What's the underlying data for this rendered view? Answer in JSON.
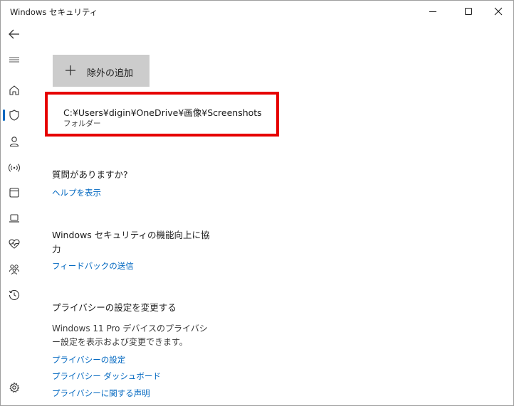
{
  "window": {
    "title": "Windows セキュリティ"
  },
  "sidebar": {
    "items": [
      {
        "icon": "back-arrow-icon"
      },
      {
        "icon": "hamburger-menu-icon"
      },
      {
        "icon": "home-icon"
      },
      {
        "icon": "shield-icon",
        "selected": true
      },
      {
        "icon": "person-icon"
      },
      {
        "icon": "wifi-antenna-icon"
      },
      {
        "icon": "app-browser-icon"
      },
      {
        "icon": "laptop-icon"
      },
      {
        "icon": "heart-pulse-icon"
      },
      {
        "icon": "family-icon"
      },
      {
        "icon": "history-icon"
      },
      {
        "icon": "gear-icon"
      }
    ]
  },
  "main": {
    "add_button_label": "除外の追加",
    "exclusion": {
      "path": "C:¥Users¥digin¥OneDrive¥画像¥Screenshots",
      "type": "フォルダー"
    },
    "help": {
      "heading": "質問がありますか?",
      "link": "ヘルプを表示"
    },
    "feedback": {
      "heading": "Windows セキュリティの機能向上に協力",
      "link": "フィードバックの送信"
    },
    "privacy": {
      "heading": "プライバシーの設定を変更する",
      "description": "Windows 11 Pro デバイスのプライバシー設定を表示および変更できます。",
      "links": [
        "プライバシーの設定",
        "プライバシー ダッシュボード",
        "プライバシーに関する声明"
      ]
    }
  },
  "colors": {
    "accent": "#0067c0",
    "highlight_border": "#e60000",
    "button_bg": "#cccccc"
  }
}
